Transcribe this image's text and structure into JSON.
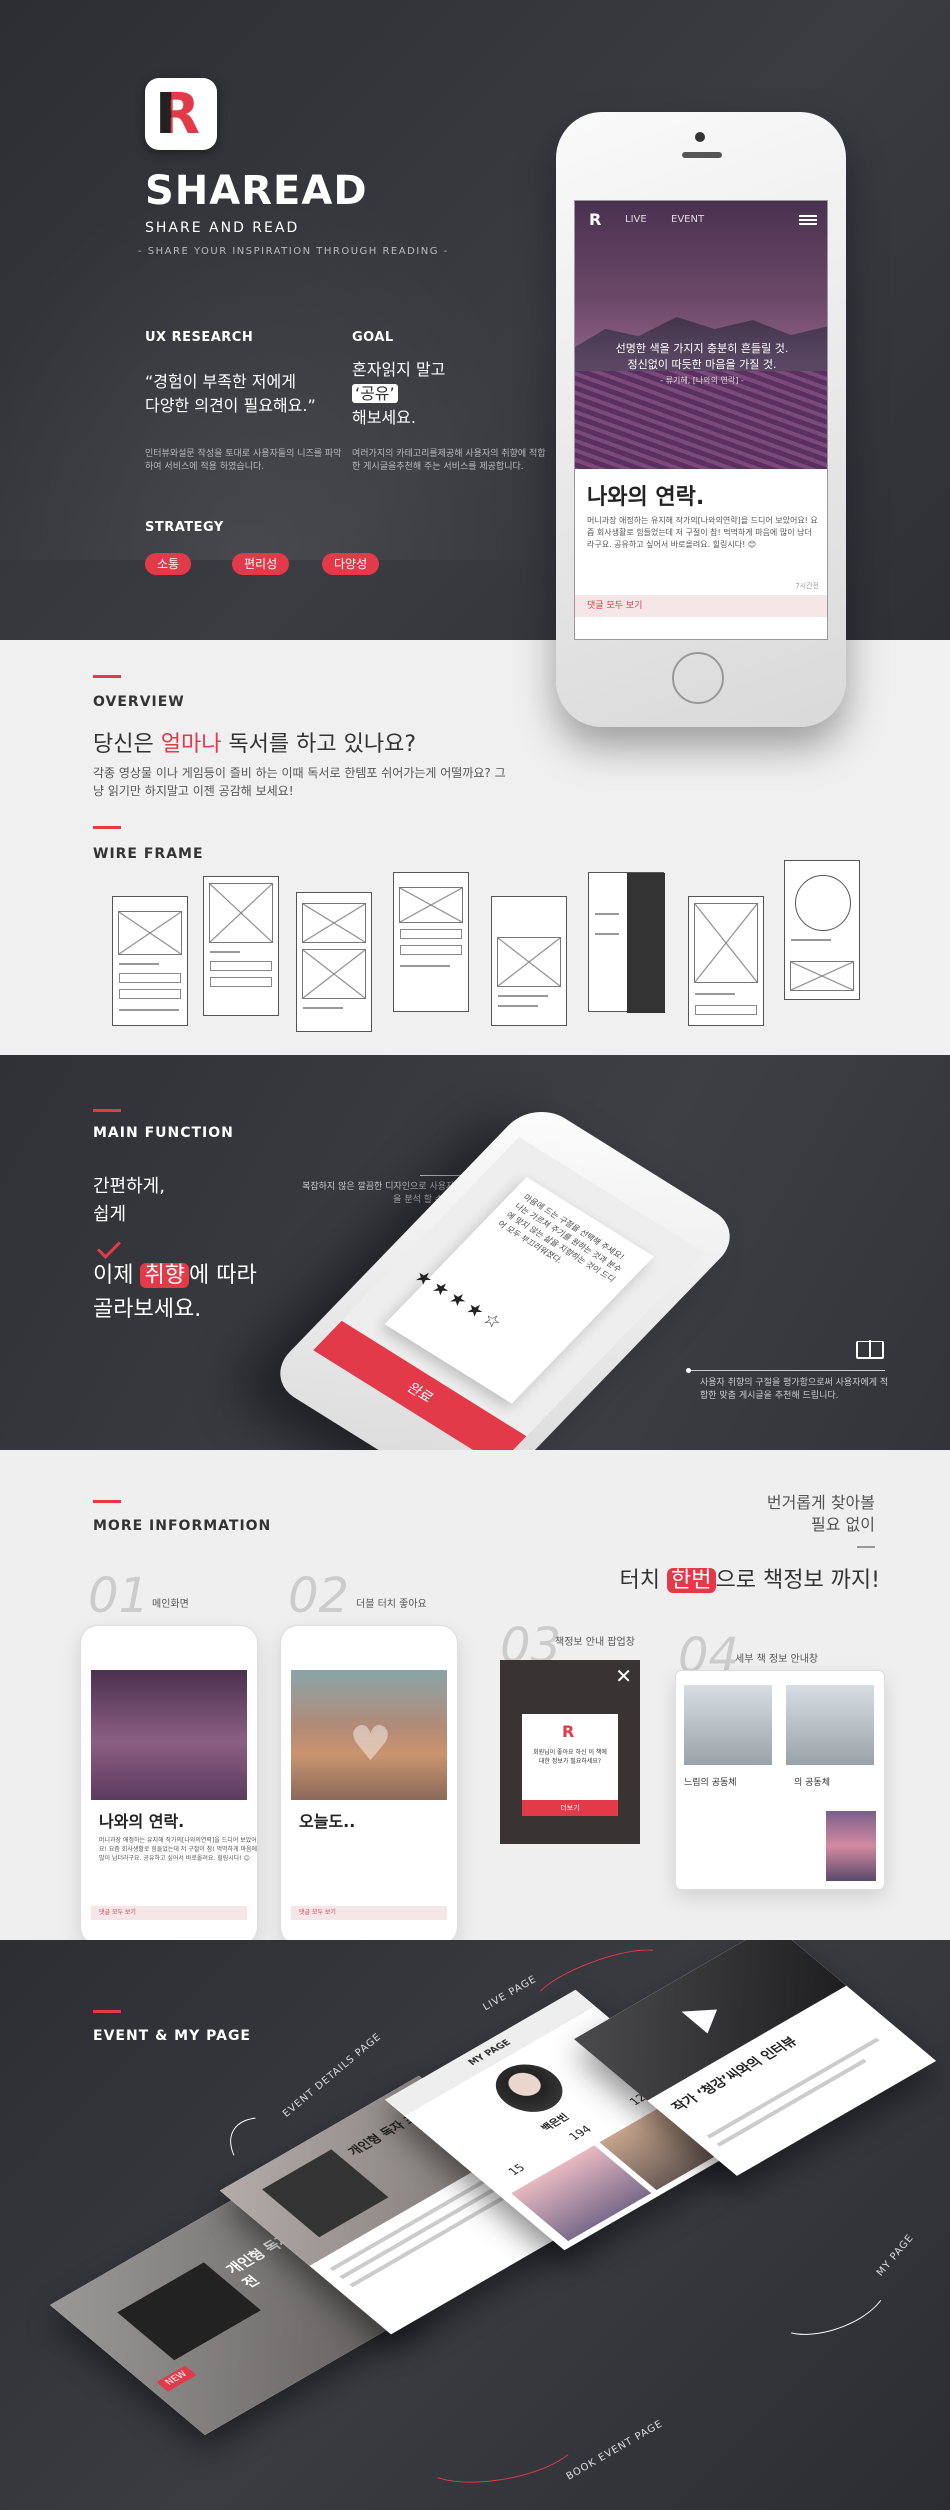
{
  "hero": {
    "brand": "SHAREAD",
    "subtitle": "SHARE AND READ",
    "tagline": "- SHARE YOUR INSPIRATION THROUGH READING -",
    "ux_label": "UX RESEARCH",
    "ux_quote_1": "“경험이 부족한 저에게",
    "ux_quote_2": "다양한 의견이 필요해요.”",
    "ux_desc": "인터뷰와설문 작성을 토대로 사용자들의 니즈를 파악하여 서비스에 적용 하였습니다.",
    "goal_label": "GOAL",
    "goal_1": "혼자읽지 말고",
    "goal_2": "‘공유’",
    "goal_3": "해보세요.",
    "goal_desc": "여러가지의 카테고리를제공해 사용자의 취향에 적합한 게시글을추천해 주는 서비스를 제공합니다.",
    "strategy_label": "STRATEGY",
    "pills": [
      "소통",
      "편리성",
      "다양성"
    ]
  },
  "phone": {
    "nav_live": "LIVE",
    "nav_event": "EVENT",
    "quote_1": "선명한 색을 가지지 충분히 흔들릴 것.",
    "quote_2": "정신없이 따듯한 마음을 가질 것.",
    "quote_cite": "- 류기혜, [나와의 연락] -",
    "title": "나와의 연락.",
    "body": "머니과장 애정하는 유지해 작가의[나와의연락]을 드디어 보았어요! 요즘 회사생활로 힘들었는데 저 구절이 참! 먹먹하게 마음에 많이 남더라구요. 공유하고 싶어서 바로올려요. 힐링시다! 😊",
    "time": "7시간전",
    "comments": "댓글 모두 보기"
  },
  "overview": {
    "label": "OVERVIEW",
    "head_pre": "당신은 ",
    "head_red": "얼마나",
    "head_post": " 독서를 하고 있나요?",
    "desc": "각종 영상물 이나 게임등이 즐비 하는 이때 독서로 한템포 쉬어가는게 어떨까요? 그냥 읽기만 하지말고 이젠 공감해 보세요!",
    "wire_label": "WIRE FRAME"
  },
  "main_function": {
    "label": "MAIN FUNCTION",
    "line1": "간편하게,",
    "line2": "쉽게",
    "big_pre": "이제 ",
    "big_chip": "취향",
    "big_post": "에 따라",
    "big_2": "골라보세요.",
    "note_1": "복잡하지 않은 깔끔한 디자인으로 사용자의 취향을 분석 할 수 있습니다.",
    "note_2": "사용자 취향의 구절을 평가함으로써 사용자에게 적합한 맞춤 게시글을 추천해 드립니다.",
    "card_text": "마음에 드는 구절을 선택해 주세요! 나는 가르쳐 주기를 원하는 것과 분수에 맞지 않는 삶을 지향하는 것이 드디어 모두 부끄러워졌다.",
    "stars": "★★★★☆",
    "btn": "완료"
  },
  "more": {
    "label": "MORE INFORMATION",
    "right_1": "번거롭게 찾아볼",
    "right_2": "필요 없이",
    "touch_pre": "터치 ",
    "touch_chip": "한번",
    "touch_post": "으로 책정보 까지!",
    "items": [
      {
        "num": "01",
        "caption": "메인화면"
      },
      {
        "num": "02",
        "caption": "더블 터치 좋아요"
      },
      {
        "num": "03",
        "caption": "책정보 안내 팝업창"
      },
      {
        "num": "04",
        "caption": "세부 책 정보 안내창"
      }
    ],
    "card1_title": "나와의 연락.",
    "card2_title": "오늘도..",
    "card_comments": "댓글 모두 보기",
    "popup_text": "회원님이 좋아요 하신 이 책에 대한 정보가 필요하세요?",
    "popup_btn": "더보기",
    "detail_1": "느림의 공동체",
    "detail_2": "의 공동체"
  },
  "event": {
    "label": "EVENT & MY PAGE",
    "live_page": "LIVE PAGE",
    "event_details": "EVENT DETAILS PAGE",
    "my_page": "MY PAGE",
    "book_event": "BOOK EVENT PAGE",
    "screen_a_title": "개인형 독자 초대전",
    "screen_b_title": "작가 ‘청강’씨와의 인터뷰",
    "my_page_title": "MY PAGE",
    "profile_name": "백은빈",
    "stats": [
      "15",
      "194",
      "12"
    ],
    "new_badge": "NEW"
  },
  "colors": {
    "accent": "#e23a48",
    "dark": "#2f3136"
  }
}
